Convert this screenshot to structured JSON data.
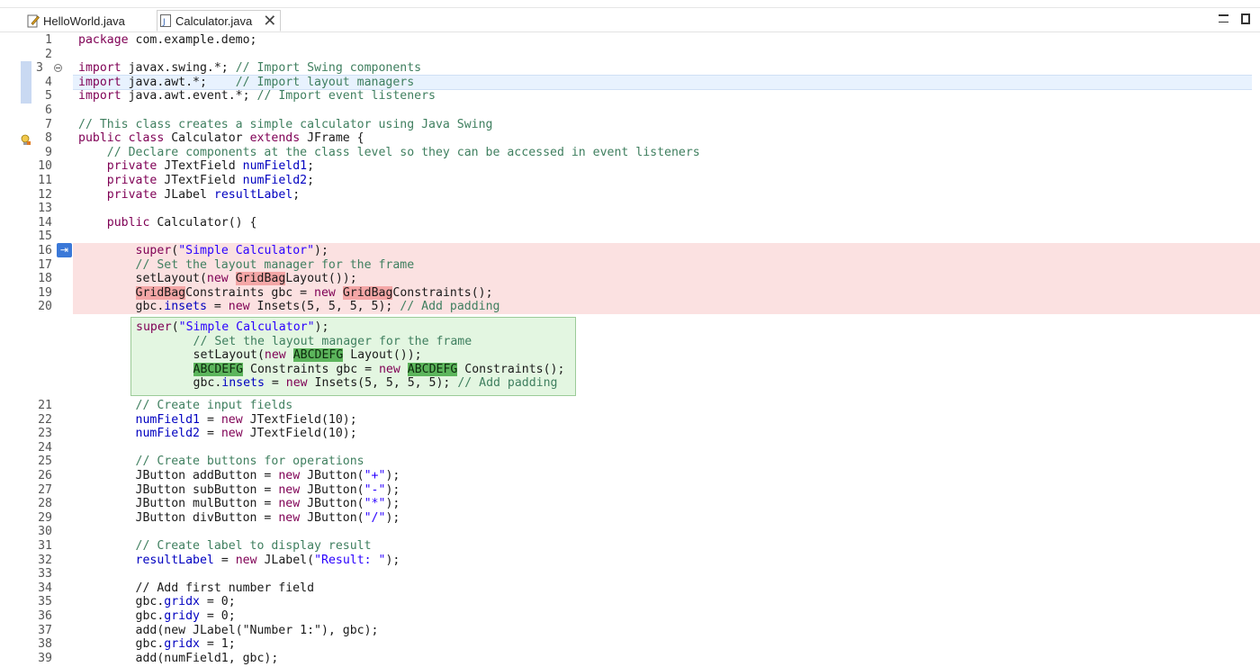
{
  "tabs": [
    {
      "label": "HelloWorld.java",
      "icon": "java-file-edit-icon"
    },
    {
      "label": "Calculator.java",
      "icon": "java-file-icon",
      "active": true
    }
  ],
  "colors": {
    "removed": "#fbe1e1",
    "added": "#e3f6e1",
    "keyword": "#7f0055",
    "comment": "#3f7f5f",
    "field": "#0000c0",
    "string": "#2a00ff"
  },
  "lines": [
    {
      "n": "1",
      "code": "package com.example.demo;"
    },
    {
      "n": "2",
      "code": ""
    },
    {
      "n": "3",
      "code": "import javax.swing.*; // Import Swing components"
    },
    {
      "n": "4",
      "code": "import java.awt.*;    // Import layout managers"
    },
    {
      "n": "5",
      "code": "import java.awt.event.*; // Import event listeners"
    },
    {
      "n": "6",
      "code": ""
    },
    {
      "n": "7",
      "code": "// This class creates a simple calculator using Java Swing"
    },
    {
      "n": "8",
      "code": "public class Calculator extends JFrame {"
    },
    {
      "n": "9",
      "code": "    // Declare components at the class level so they can be accessed in event listeners"
    },
    {
      "n": "10",
      "code": "    private JTextField numField1;"
    },
    {
      "n": "11",
      "code": "    private JTextField numField2;"
    },
    {
      "n": "12",
      "code": "    private JLabel resultLabel;"
    },
    {
      "n": "13",
      "code": ""
    },
    {
      "n": "14",
      "code": "    public Calculator() {"
    },
    {
      "n": "15",
      "code": ""
    },
    {
      "n": "16",
      "code": "        super(\"Simple Calculator\");"
    },
    {
      "n": "17",
      "code": "        // Set the layout manager for the frame"
    },
    {
      "n": "18",
      "code": "        setLayout(new GridBagLayout());"
    },
    {
      "n": "19",
      "code": "        GridBagConstraints gbc = new GridBagConstraints();"
    },
    {
      "n": "20",
      "code": "        gbc.insets = new Insets(5, 5, 5, 5); // Add padding"
    },
    {
      "n": "21",
      "code": "        // Create input fields"
    },
    {
      "n": "22",
      "code": "        numField1 = new JTextField(10);"
    },
    {
      "n": "23",
      "code": "        numField2 = new JTextField(10);"
    },
    {
      "n": "24",
      "code": ""
    },
    {
      "n": "25",
      "code": "        // Create buttons for operations"
    },
    {
      "n": "26",
      "code": "        JButton addButton = new JButton(\"+\");"
    },
    {
      "n": "27",
      "code": "        JButton subButton = new JButton(\"-\");"
    },
    {
      "n": "28",
      "code": "        JButton mulButton = new JButton(\"*\");"
    },
    {
      "n": "29",
      "code": "        JButton divButton = new JButton(\"/\");"
    },
    {
      "n": "30",
      "code": ""
    },
    {
      "n": "31",
      "code": "        // Create label to display result"
    },
    {
      "n": "32",
      "code": "        resultLabel = new JLabel(\"Result: \");"
    },
    {
      "n": "33",
      "code": ""
    },
    {
      "n": "34",
      "code": "        // Add first number field"
    },
    {
      "n": "35",
      "code": "        gbc.gridx = 0;"
    },
    {
      "n": "36",
      "code": "        gbc.gridy = 0;"
    },
    {
      "n": "37",
      "code": "        add(new JLabel(\"Number 1:\"), gbc);"
    },
    {
      "n": "38",
      "code": "        gbc.gridx = 1;"
    },
    {
      "n": "39",
      "code": "        add(numField1, gbc);"
    }
  ],
  "suggestion": [
    "super(\"Simple Calculator\");",
    "        // Set the layout manager for the frame",
    "        setLayout(new ABCDEFG Layout());",
    "        ABCDEFG Constraints gbc = new ABCDEFG Constraints();",
    "        gbc.insets = new Insets(5, 5, 5, 5); // Add padding"
  ]
}
